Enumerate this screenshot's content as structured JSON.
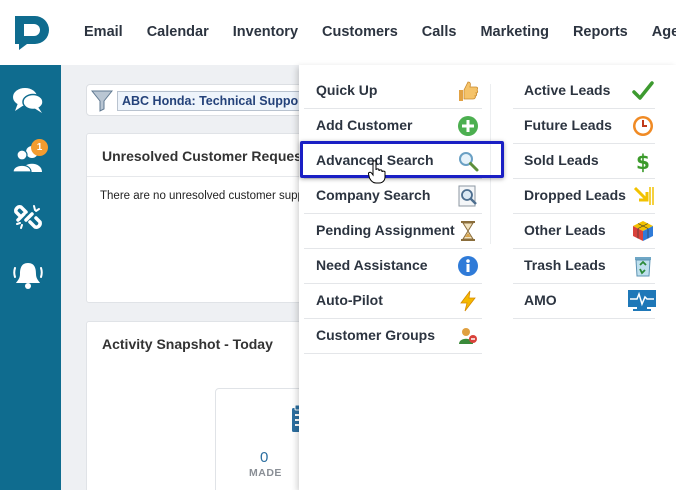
{
  "nav": {
    "items": [
      {
        "label": "Email"
      },
      {
        "label": "Calendar"
      },
      {
        "label": "Inventory"
      },
      {
        "label": "Customers"
      },
      {
        "label": "Calls"
      },
      {
        "label": "Marketing"
      },
      {
        "label": "Reports"
      },
      {
        "label": "Agents"
      }
    ]
  },
  "sidebar": {
    "icons": [
      "chat-icon",
      "users-icon",
      "unlink-icon",
      "bell-icon"
    ],
    "users_badge": "1"
  },
  "filter": {
    "selected": "ABC Honda: Technical Support"
  },
  "cards": {
    "unresolved": {
      "title": "Unresolved Customer Requests",
      "text": "There are no unresolved customer support requests"
    },
    "activity": {
      "title": "Activity Snapshot - Today",
      "made_value": "0",
      "made_label": "MADE"
    }
  },
  "customers_menu": {
    "left": [
      {
        "label": "Quick Up",
        "icon": "thumbs-up-icon"
      },
      {
        "label": "Add Customer",
        "icon": "plus-circle-icon"
      },
      {
        "label": "Advanced Search",
        "icon": "magnifier-icon"
      },
      {
        "label": "Company Search",
        "icon": "document-search-icon"
      },
      {
        "label": "Pending Assignment",
        "icon": "hourglass-icon"
      },
      {
        "label": "Need Assistance",
        "icon": "info-icon"
      },
      {
        "label": "Auto-Pilot",
        "icon": "lightning-icon"
      },
      {
        "label": "Customer Groups",
        "icon": "user-group-icon"
      }
    ],
    "right": [
      {
        "label": "Active Leads",
        "icon": "checkmark-icon"
      },
      {
        "label": "Future Leads",
        "icon": "clock-icon"
      },
      {
        "label": "Sold Leads",
        "icon": "dollar-icon"
      },
      {
        "label": "Dropped Leads",
        "icon": "down-arrow-icon"
      },
      {
        "label": "Other Leads",
        "icon": "cube-icon"
      },
      {
        "label": "Trash Leads",
        "icon": "recycle-bin-icon"
      },
      {
        "label": "AMO",
        "icon": "monitor-pulse-icon"
      }
    ],
    "highlighted": "Advanced Search"
  },
  "colors": {
    "sidebar": "#0f6c8f",
    "highlight_border": "#1a1fc4",
    "badge": "#f39c2f"
  }
}
